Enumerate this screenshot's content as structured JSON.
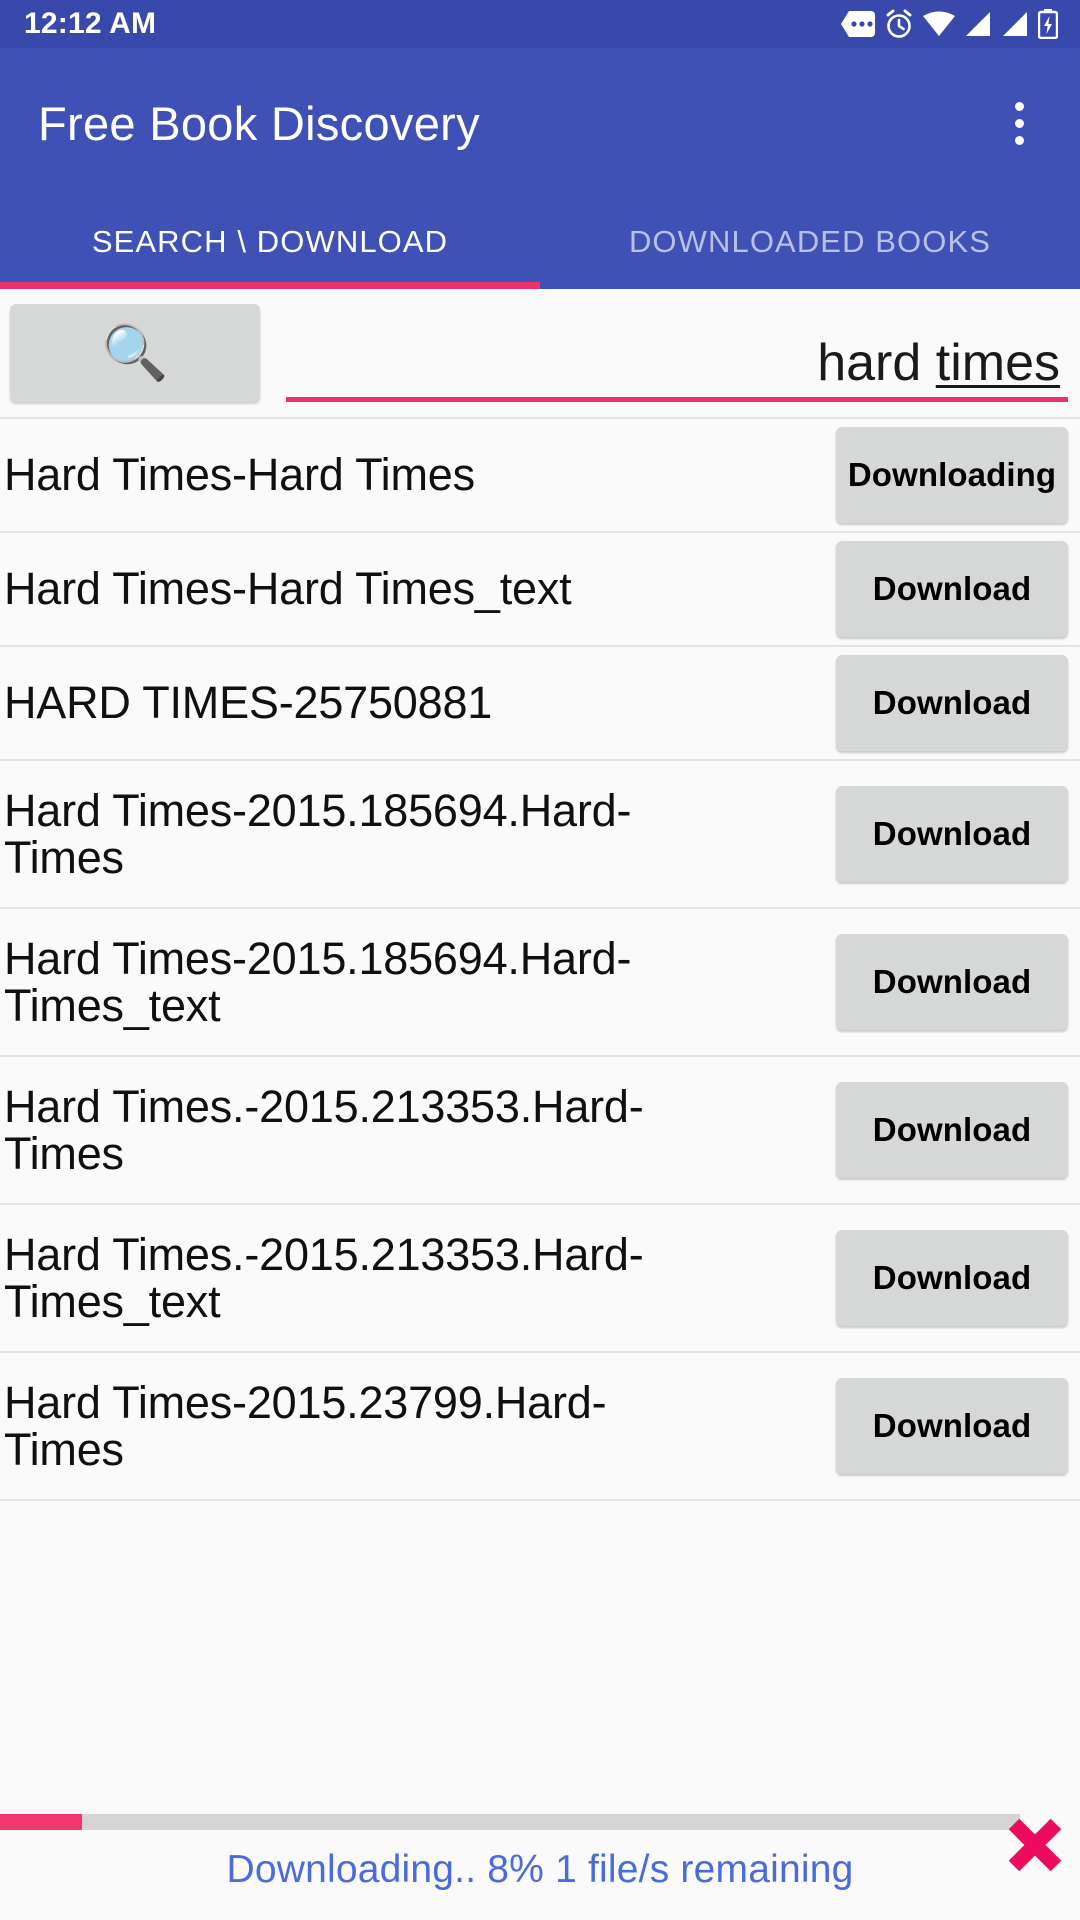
{
  "status_bar": {
    "time": "12:12 AM",
    "icons": [
      "message-icon",
      "alarm-icon",
      "wifi-icon",
      "signal-icon",
      "signal-icon",
      "battery-charging-icon"
    ]
  },
  "app_bar": {
    "title": "Free Book Discovery",
    "overflow_icon": "overflow-menu-icon"
  },
  "tabs": {
    "items": [
      {
        "label": "SEARCH \\ DOWNLOAD",
        "active": true
      },
      {
        "label": "DOWNLOADED BOOKS",
        "active": false
      }
    ],
    "indicator_color": "#e8336d"
  },
  "search": {
    "button_icon": "search-icon",
    "button_glyph": "🔍",
    "value": "hard times",
    "value_plain": "hard ",
    "value_composing": "times",
    "placeholder": "",
    "underline_color": "#e8336d"
  },
  "results": [
    {
      "title": "Hard Times-Hard Times",
      "action": "Downloading",
      "lines": 1
    },
    {
      "title": "Hard Times-Hard Times_text",
      "action": "Download",
      "lines": 1
    },
    {
      "title": "HARD TIMES-25750881",
      "action": "Download",
      "lines": 1
    },
    {
      "title": "Hard Times-2015.185694.Hard-Times",
      "action": "Download",
      "lines": 2
    },
    {
      "title": "Hard Times-2015.185694.Hard-Times_text",
      "action": "Download",
      "lines": 2
    },
    {
      "title": "Hard Times.-2015.213353.Hard-Times",
      "action": "Download",
      "lines": 2
    },
    {
      "title": "Hard Times.-2015.213353.Hard-Times_text",
      "action": "Download",
      "lines": 2
    },
    {
      "title": "Hard Times-2015.23799.Hard-Times",
      "action": "Download",
      "lines": 2
    }
  ],
  "footer": {
    "status_text": "Downloading.. 8% 1 file/s remaining",
    "progress_percent": 8,
    "progress_color": "#f2386f",
    "status_color": "#4a6bdb",
    "cancel_icon": "close-x-icon",
    "cancel_color": "#ec0b5c"
  },
  "colors": {
    "status_bar": "#3949ab",
    "app_bar": "#3f51b5",
    "accent": "#e8336d",
    "button_bg": "#d6d7d7",
    "page_bg": "#fafafa"
  }
}
